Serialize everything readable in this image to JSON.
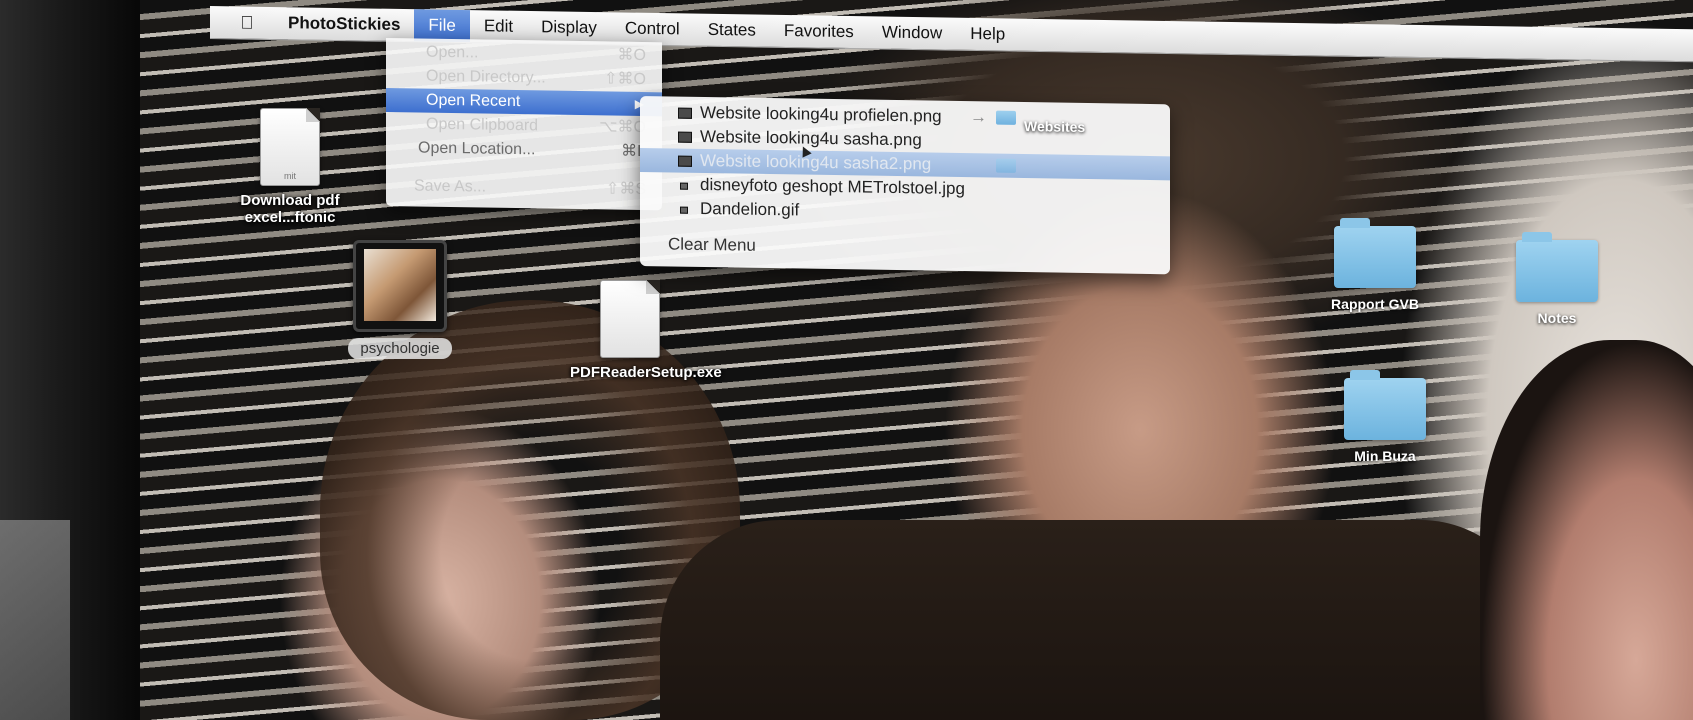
{
  "menubar": {
    "app_name": "PhotoStickies",
    "items": [
      "File",
      "Edit",
      "Display",
      "Control",
      "States",
      "Favorites",
      "Window",
      "Help"
    ],
    "active_item": "File"
  },
  "file_menu": {
    "items": [
      {
        "label": "Open...",
        "shortcut": "⌘O",
        "state": "disabled"
      },
      {
        "label": "Open Directory...",
        "shortcut": "⇧⌘O",
        "state": "disabled"
      },
      {
        "label": "Open Recent",
        "shortcut": "▶",
        "state": "highlighted"
      },
      {
        "label": "Open Clipboard",
        "shortcut": "⌥⌘O",
        "state": "disabled"
      },
      {
        "label": "Open Location...",
        "shortcut": "⌘L",
        "state": "enabled"
      },
      {
        "label": "Save As...",
        "shortcut": "⇧⌘S",
        "state": "disabled"
      }
    ]
  },
  "open_recent": {
    "items": [
      {
        "name": "Website looking4u profielen.png",
        "folder": "Websites"
      },
      {
        "name": "Website looking4u sasha.png",
        "folder": ""
      },
      {
        "name": "Website looking4u sasha2.png",
        "folder": "",
        "highlighted": true
      },
      {
        "name": "disneyfoto geshopt METrolstoel.jpg",
        "folder": ""
      },
      {
        "name": "Dandelion.gif",
        "folder": ""
      }
    ],
    "clear_label": "Clear Menu"
  },
  "desktop": {
    "icons": [
      {
        "label": "Download pdf excel...ftonic",
        "ext": "mit"
      },
      {
        "label": "psychologie"
      },
      {
        "label": "PDFReaderSetup.exe"
      },
      {
        "label": "Rapport GVB"
      },
      {
        "label": "Notes"
      },
      {
        "label": "Min Buza"
      }
    ]
  }
}
